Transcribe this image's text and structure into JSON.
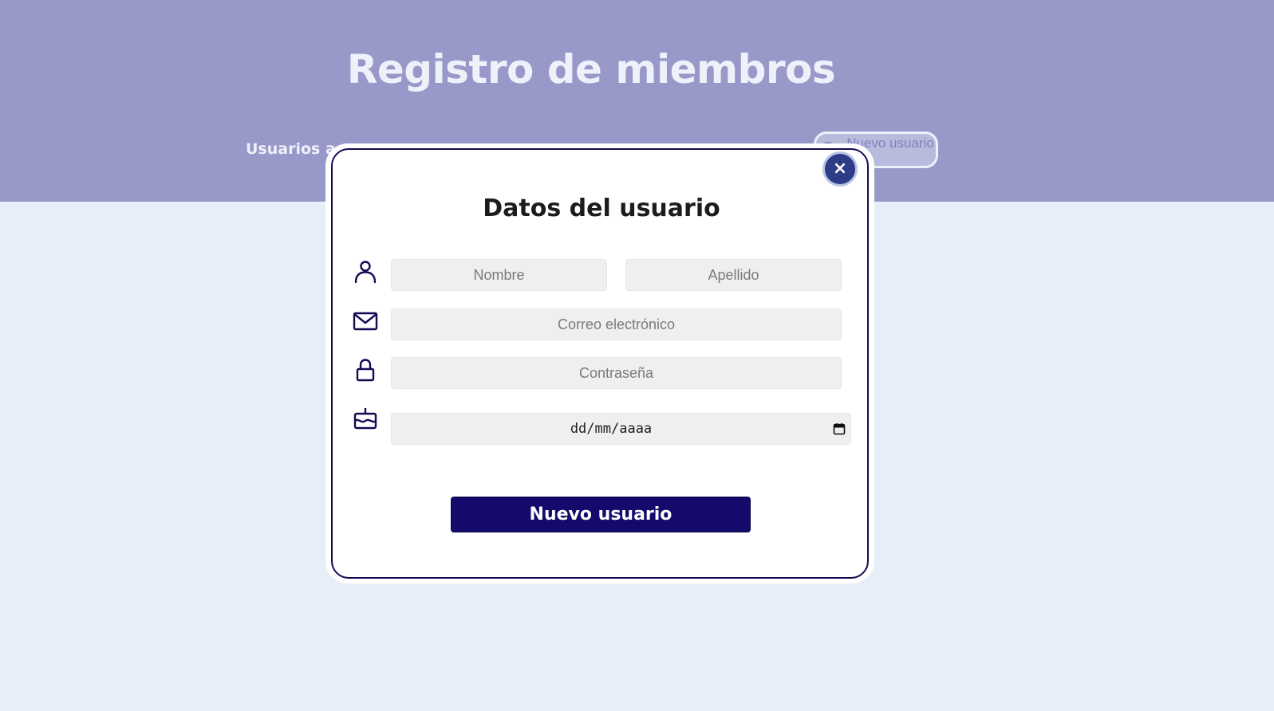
{
  "header": {
    "title": "Registro de miembros",
    "active_users_label": "Usuarios ac",
    "new_user_button": "Nuevo usuario"
  },
  "modal": {
    "close_symbol": "×",
    "title": "Datos del usuario",
    "fields": {
      "first_name_placeholder": "Nombre",
      "last_name_placeholder": "Apellido",
      "email_placeholder": "Correo electrónico",
      "password_placeholder": "Contraseña",
      "birthdate_placeholder": "dd/mm/aaaa"
    },
    "submit_label": "Nuevo usuario"
  },
  "colors": {
    "header_bg": "#9899c8",
    "page_bg": "#e8eef8",
    "accent": "#130a6c",
    "icon": "#130a52",
    "close_button": "#2e3c88"
  },
  "icons": [
    "user-icon",
    "mail-icon",
    "lock-icon",
    "cake-icon",
    "calendar-icon",
    "close-icon"
  ]
}
